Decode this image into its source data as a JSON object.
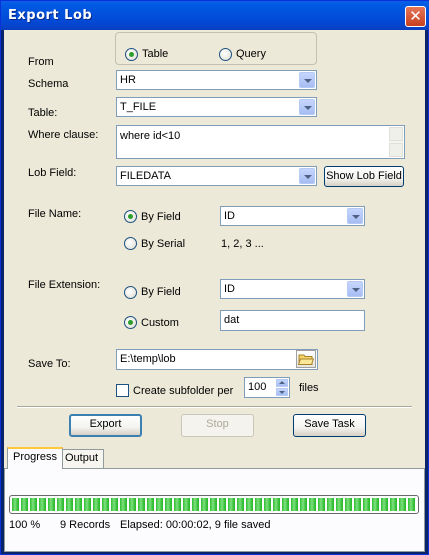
{
  "window": {
    "title": "Export Lob",
    "close_glyph": "✕"
  },
  "from": {
    "label": "From",
    "options": [
      {
        "label": "Table",
        "selected": true
      },
      {
        "label": "Query",
        "selected": false
      }
    ]
  },
  "schema": {
    "label": "Schema",
    "value": "HR"
  },
  "table": {
    "label": "Table:",
    "value": "T_FILE"
  },
  "where": {
    "label": "Where clause:",
    "value": "where id<10"
  },
  "lob_field": {
    "label": "Lob Field:",
    "value": "FILEDATA",
    "button": "Show Lob Field"
  },
  "file_name": {
    "label": "File Name:",
    "by_field_label": "By Field",
    "by_field_selected": true,
    "field_value": "ID",
    "by_serial_label": "By Serial",
    "by_serial_selected": false,
    "serial_example": "1, 2, 3 ..."
  },
  "file_extension": {
    "label": "File Extension:",
    "by_field_label": "By Field",
    "by_field_selected": false,
    "field_value": "ID",
    "custom_label": "Custom",
    "custom_selected": true,
    "custom_value": "dat"
  },
  "save_to": {
    "label": "Save To:",
    "path": "E:\\temp\\lob",
    "subfolder_label": "Create subfolder per",
    "subfolder_checked": false,
    "files_per_folder": "100",
    "files_label": "files"
  },
  "buttons": {
    "export": "Export",
    "stop": "Stop",
    "save_task": "Save Task"
  },
  "tabs": [
    {
      "label": "Progress",
      "active": true
    },
    {
      "label": "Output",
      "active": false
    }
  ],
  "progress": {
    "fraction": 1.0,
    "percent_text": "100 %",
    "records_text": "9 Records",
    "status_text": "Elapsed: 00:00:02, 9 file saved"
  },
  "colors": {
    "titlebar": "#0058e1",
    "dialog_bg": "#ece9d8",
    "progress_green": "#2fbc2f",
    "close_red": "#c8401d"
  },
  "icons": {
    "close": "close-icon",
    "folder": "folder-open-icon",
    "dropdown": "chevron-down-icon"
  }
}
